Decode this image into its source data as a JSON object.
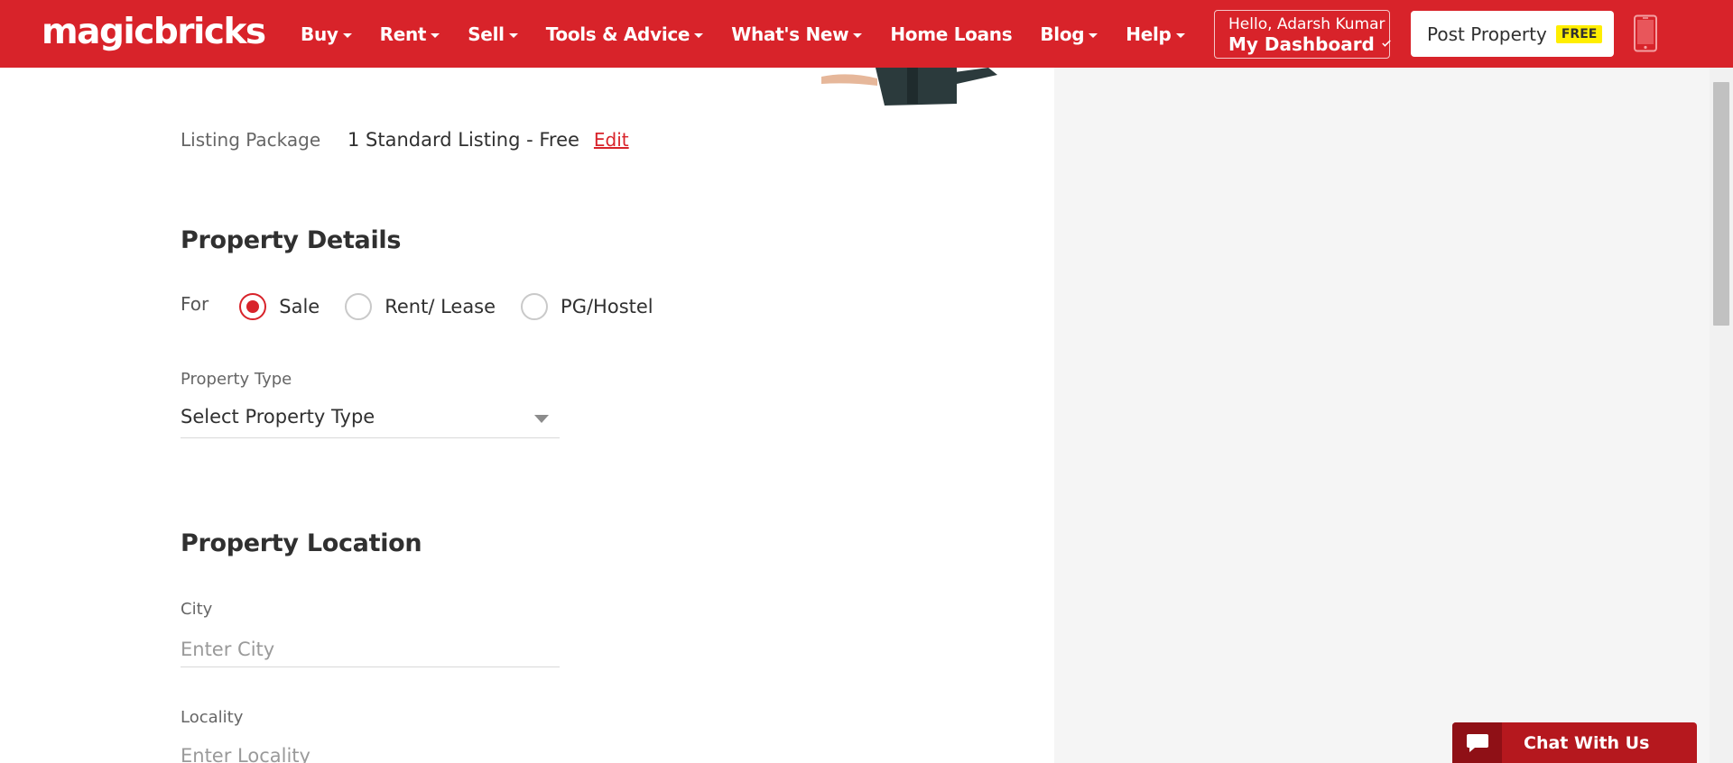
{
  "header": {
    "logo": "magicbricks",
    "nav": [
      {
        "label": "Buy",
        "has_caret": true
      },
      {
        "label": "Rent",
        "has_caret": true
      },
      {
        "label": "Sell",
        "has_caret": true
      },
      {
        "label": "Tools & Advice",
        "has_caret": true
      },
      {
        "label": "What's New",
        "has_caret": true
      },
      {
        "label": "Home Loans",
        "has_caret": false
      },
      {
        "label": "Blog",
        "has_caret": true
      },
      {
        "label": "Help",
        "has_caret": true
      }
    ],
    "greeting": "Hello, Adarsh Kumar",
    "dashboard_label": "My Dashboard",
    "post_property_label": "Post Property",
    "free_badge": "FREE",
    "brand_color": "#d8232a"
  },
  "listing": {
    "label": "Listing Package",
    "value": "1 Standard Listing - Free",
    "edit_label": "Edit"
  },
  "property_details": {
    "title": "Property Details",
    "for_label": "For",
    "options": [
      {
        "label": "Sale",
        "checked": true
      },
      {
        "label": "Rent/ Lease",
        "checked": false
      },
      {
        "label": "PG/Hostel",
        "checked": false
      }
    ],
    "type_label": "Property Type",
    "type_value": "Select Property Type"
  },
  "property_location": {
    "title": "Property Location",
    "city_label": "City",
    "city_placeholder": "Enter City",
    "locality_label": "Locality",
    "locality_placeholder": "Enter Locality"
  },
  "chat": {
    "label": "Chat With Us"
  },
  "icons": [
    "caret-down-icon",
    "chevron-down-icon",
    "phone-icon",
    "select-arrow-icon",
    "chat-bubble-icon"
  ]
}
